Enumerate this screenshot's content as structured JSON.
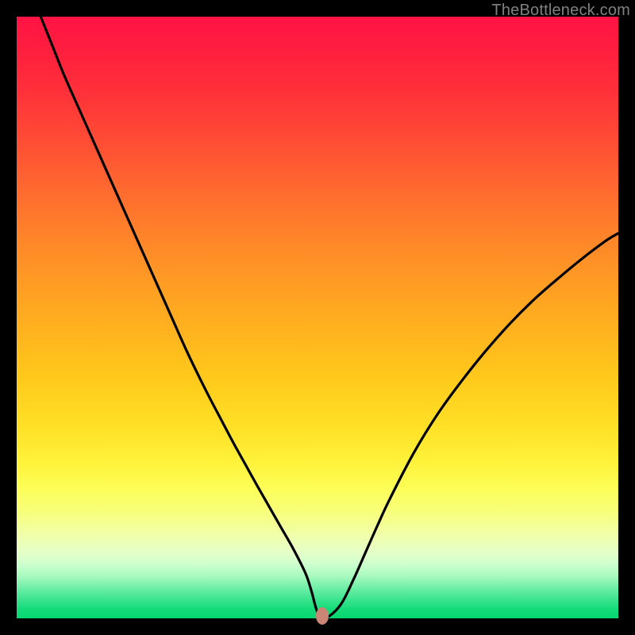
{
  "watermark": "TheBottleneck.com",
  "colors": {
    "frame": "#000000",
    "curve": "#000000",
    "marker": "#cb8574",
    "watermark_text": "#808080"
  },
  "chart_data": {
    "type": "line",
    "title": "",
    "xlabel": "",
    "ylabel": "",
    "xlim": [
      0,
      100
    ],
    "ylim": [
      0,
      100
    ],
    "grid": false,
    "legend": null,
    "x": [
      4,
      6,
      8,
      10,
      12,
      14,
      16,
      18,
      20,
      22,
      24,
      26,
      28,
      30,
      32,
      34,
      36,
      38,
      40,
      42,
      44,
      46,
      48,
      49,
      50,
      51,
      52,
      54,
      56,
      58,
      60,
      62,
      66,
      70,
      74,
      78,
      82,
      86,
      90,
      94,
      98,
      100
    ],
    "y": [
      100,
      95,
      90,
      85.5,
      81,
      76.5,
      72,
      67.5,
      63,
      58.5,
      54,
      49.5,
      45,
      40.8,
      36.8,
      33,
      29.2,
      25.6,
      22,
      18.5,
      15,
      11.5,
      7.5,
      4.5,
      1.0,
      0.4,
      0.4,
      2.5,
      6.5,
      11.0,
      15.5,
      19.8,
      27.5,
      34.0,
      39.5,
      44.5,
      49.0,
      53.0,
      56.5,
      59.8,
      62.8,
      64.0
    ],
    "marker": {
      "x": 50.8,
      "y": 0.4
    },
    "background_gradient": {
      "direction": "vertical",
      "stops": [
        {
          "pos": 0.0,
          "color": "#ff1344"
        },
        {
          "pos": 0.2,
          "color": "#ff4a35"
        },
        {
          "pos": 0.44,
          "color": "#ff9b24"
        },
        {
          "pos": 0.68,
          "color": "#ffe026"
        },
        {
          "pos": 0.82,
          "color": "#f8ff77"
        },
        {
          "pos": 0.91,
          "color": "#ceffce"
        },
        {
          "pos": 1.0,
          "color": "#07d870"
        }
      ]
    }
  }
}
